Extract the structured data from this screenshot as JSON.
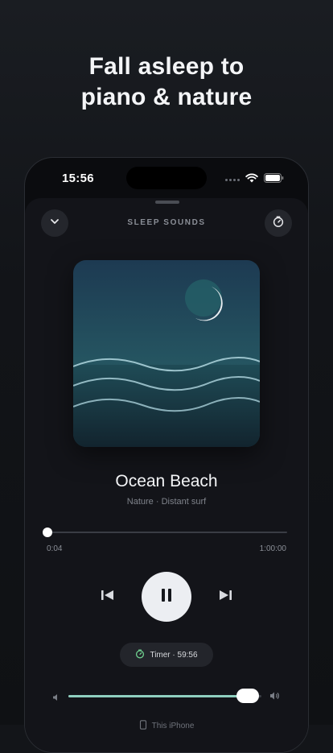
{
  "promo": {
    "headline_line1": "Fall asleep to",
    "headline_line2": "piano & nature"
  },
  "status_bar": {
    "time": "15:56"
  },
  "player": {
    "section_title": "SLEEP SOUNDS",
    "track": {
      "title": "Ocean Beach",
      "subtitle": "Nature · Distant surf"
    },
    "elapsed": "0:04",
    "duration": "1:00:00",
    "progress_fraction": 0.001,
    "is_playing": true,
    "timer_label": "Timer · 59:56",
    "volume_fraction": 0.93,
    "output_device": "This iPhone"
  },
  "icons": {
    "collapse": "chevron-down-icon",
    "sleep_timer": "timer-icon",
    "previous": "skip-previous-icon",
    "pause": "pause-icon",
    "next": "skip-next-icon",
    "volume_low": "speaker-low-icon",
    "volume_high": "speaker-high-icon",
    "output": "phone-icon"
  },
  "colors": {
    "accent": "#8fcfbf",
    "timer_accent": "#6fcf8f",
    "background": "#131519"
  }
}
